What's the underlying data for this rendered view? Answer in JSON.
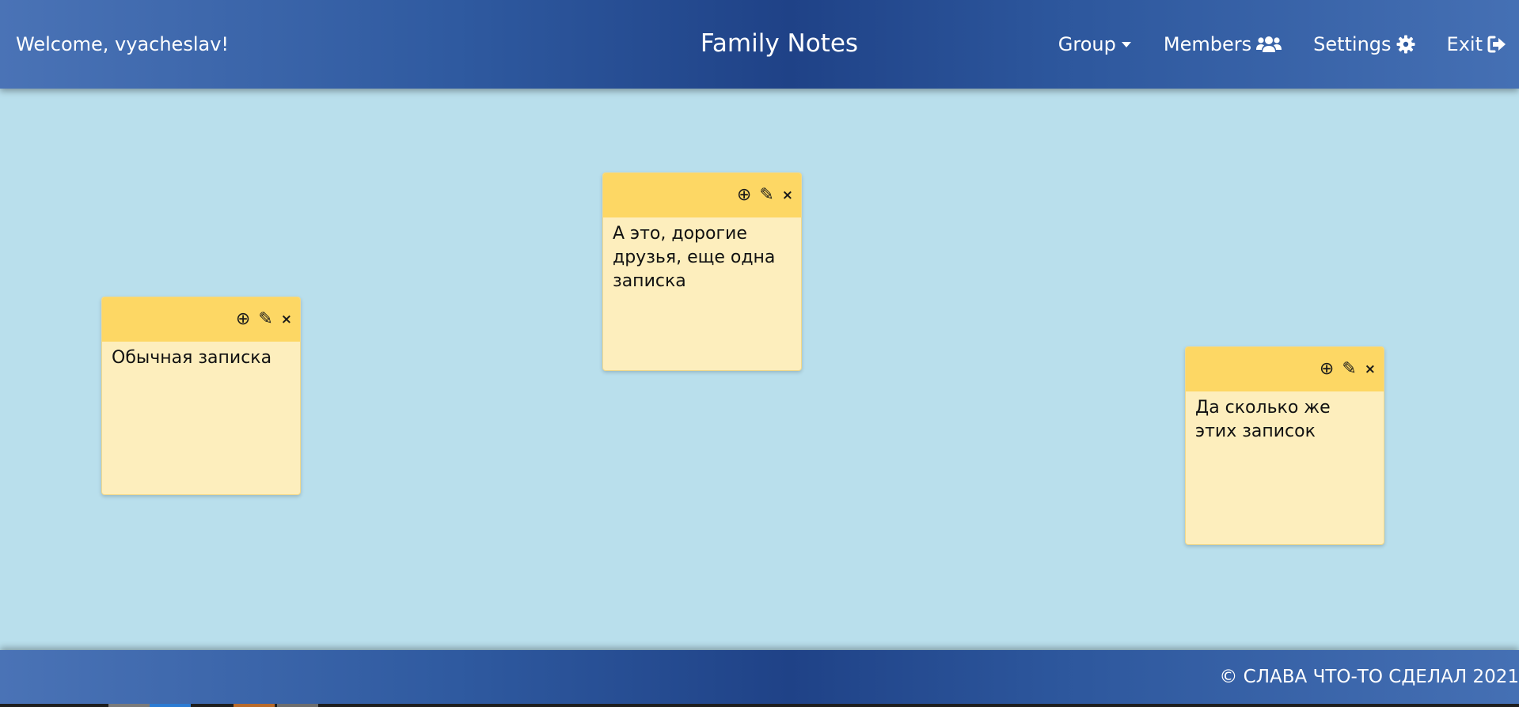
{
  "header": {
    "welcome": "Welcome, vyacheslav!",
    "title": "Family Notes",
    "nav": [
      {
        "label": "Group",
        "icon": "caret-down-icon"
      },
      {
        "label": "Members",
        "icon": "users-icon"
      },
      {
        "label": "Settings",
        "icon": "gear-icon"
      },
      {
        "label": "Exit",
        "icon": "sign-out-icon"
      }
    ]
  },
  "notes": [
    {
      "text": "Обычная записка",
      "actions": [
        "⊕",
        "✎",
        "×"
      ]
    },
    {
      "text": "А это, дорогие друзья, еще одна записка",
      "actions": [
        "⊕",
        "✎",
        "×"
      ]
    },
    {
      "text": "Да сколько же этих записок",
      "actions": [
        "⊕",
        "✎",
        "×"
      ]
    }
  ],
  "footer": {
    "copyright": "© СЛАВА ЧТО-ТО СДЕЛАЛ 2021"
  },
  "colors": {
    "background": "#b9dfec",
    "header_dark": "#1f4287",
    "header_light": "#4a73b6",
    "note_header": "#fdd764",
    "note_body": "#fdeebd"
  }
}
